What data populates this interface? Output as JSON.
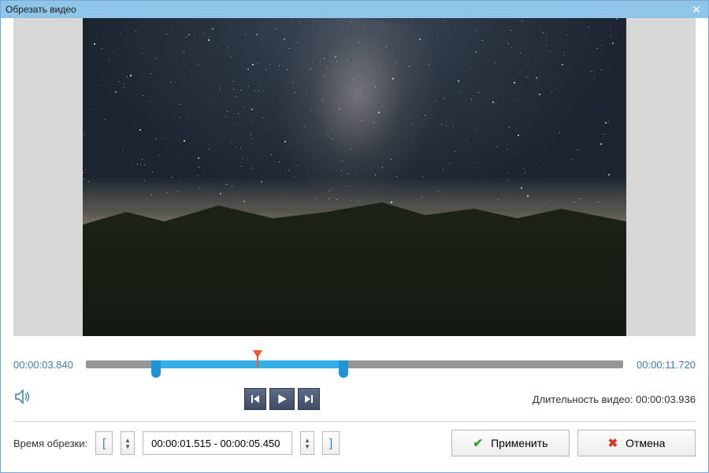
{
  "window": {
    "title": "Обрезать видео"
  },
  "timeline": {
    "current_pos": "00:00:03.840",
    "total": "00:00:11.720",
    "sel_start_pct": 13,
    "sel_end_pct": 48,
    "playhead_pct": 32
  },
  "controls": {
    "duration_label_prefix": "Длительность видео: ",
    "duration_value": "00:00:03.936"
  },
  "trim": {
    "label": "Время обрезки:",
    "left_bracket": "[",
    "right_bracket": "]",
    "range_text": "00:00:01.515 - 00:00:05.450"
  },
  "buttons": {
    "apply": "Применить",
    "cancel": "Отмена"
  }
}
